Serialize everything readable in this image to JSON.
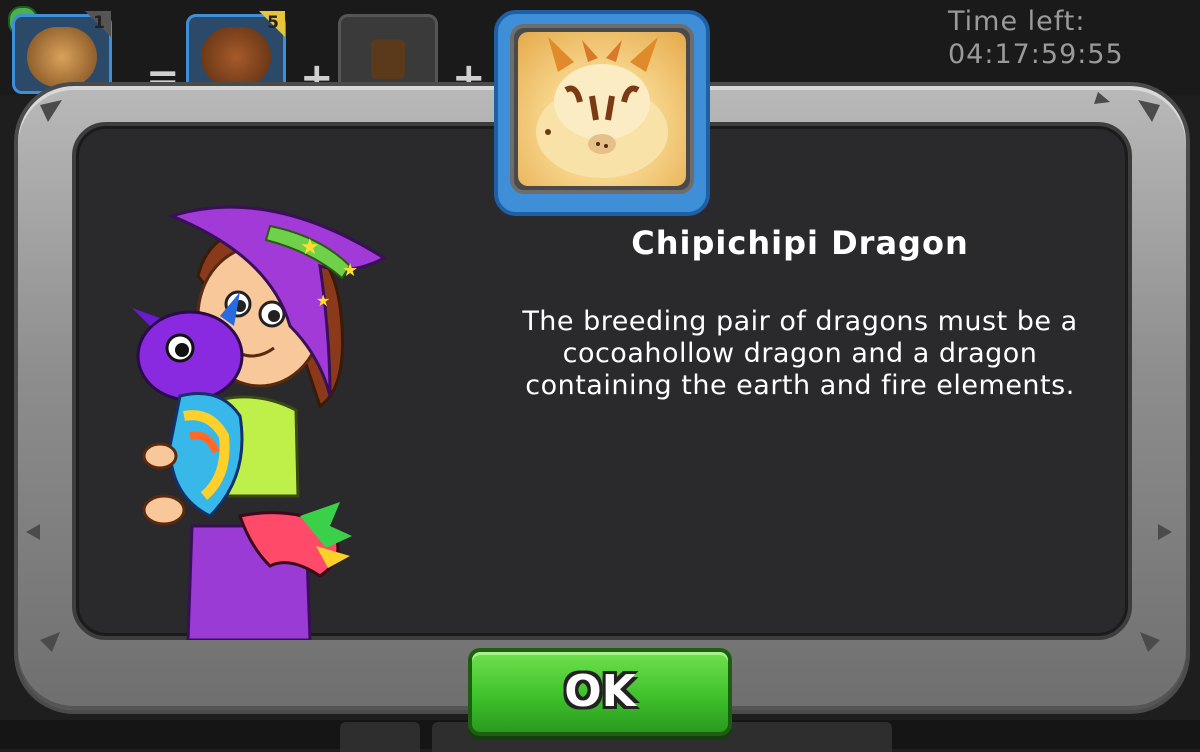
{
  "timer": {
    "label": "Time left:",
    "value": "04:17:59:55"
  },
  "breeding_slots": [
    {
      "name": "cocoahollow",
      "count": "1"
    },
    {
      "name": "dragon-2",
      "count": "5"
    },
    {
      "name": "empty-slot-1",
      "count": ""
    }
  ],
  "operators": [
    "=",
    "+",
    "+"
  ],
  "dialog": {
    "title": "Chipichipi Dragon",
    "description": "The breeding pair of dragons must be a cocoahollow dragon and a dragon containing the earth and fire elements.",
    "ok_label": "OK"
  },
  "colors": {
    "ok_button": "#3fc22c",
    "portrait_border": "#3f8fd8",
    "panel_bg": "#2a292b"
  }
}
